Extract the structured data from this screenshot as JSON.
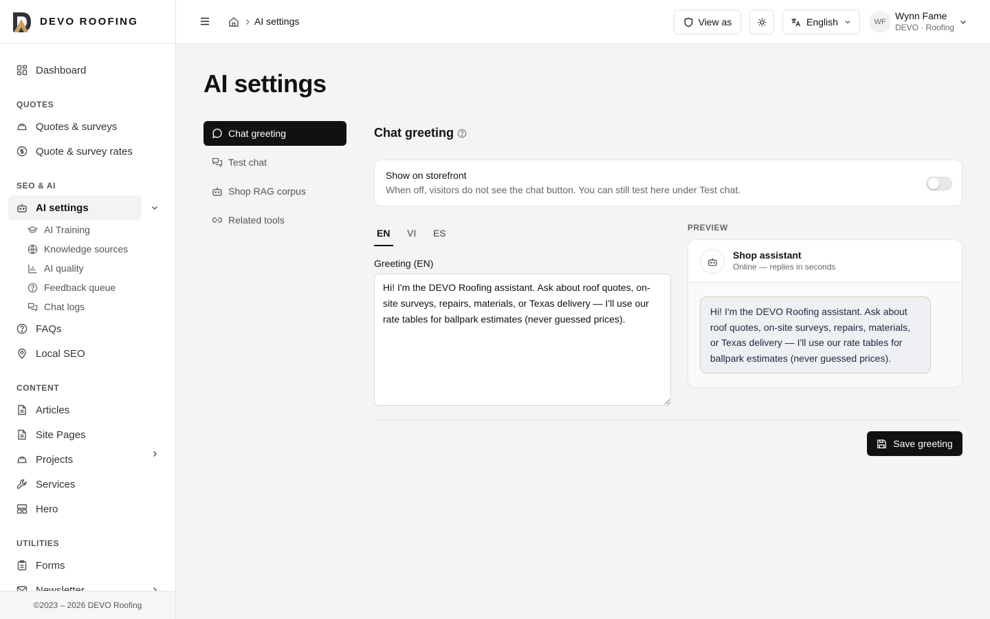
{
  "brand": {
    "name": "DEVO ROOFING"
  },
  "sidebar": {
    "dashboard": "Dashboard",
    "sections": {
      "quotes": "QUOTES",
      "seo_ai": "SEO & AI",
      "content": "CONTENT",
      "utilities": "UTILITIES"
    },
    "quotes_surveys": "Quotes & surveys",
    "quote_rates": "Quote & survey rates",
    "ai_settings": "AI settings",
    "ai_sub": [
      "AI Training",
      "Knowledge sources",
      "AI quality",
      "Feedback queue",
      "Chat logs"
    ],
    "faqs": "FAQs",
    "local_seo": "Local SEO",
    "articles": "Articles",
    "site_pages": "Site Pages",
    "projects": "Projects",
    "services": "Services",
    "hero": "Hero",
    "forms": "Forms",
    "newsletter": "Newsletter",
    "footer": "©2023 – 2026 DEVO Roofing"
  },
  "header": {
    "breadcrumb": "AI settings",
    "view_as": "View as",
    "language": "English",
    "user": {
      "initials": "WF",
      "name": "Wynn Fame",
      "org": "DEVO · Roofing"
    }
  },
  "page": {
    "title": "AI settings",
    "tabs": [
      "Chat greeting",
      "Test chat",
      "Shop RAG corpus",
      "Related tools"
    ],
    "section_title": "Chat greeting",
    "storefront": {
      "title": "Show on storefront",
      "description": "When off, visitors do not see the chat button. You can still test here under Test chat.",
      "enabled": false
    },
    "lang_tabs": [
      "EN",
      "VI",
      "ES"
    ],
    "greeting_label": "Greeting (EN)",
    "greeting_text": "Hi! I'm the DEVO Roofing assistant. Ask about roof quotes, on-site surveys, repairs, materials, or Texas delivery — I'll use our rate tables for ballpark estimates (never guessed prices).",
    "preview": {
      "label": "PREVIEW",
      "name": "Shop assistant",
      "status": "Online — replies in seconds",
      "message": "Hi! I'm the DEVO Roofing assistant. Ask about roof quotes, on-site surveys, repairs, materials, or Texas delivery — I'll use our rate tables for ballpark estimates (never guessed prices)."
    },
    "save_label": "Save greeting"
  }
}
